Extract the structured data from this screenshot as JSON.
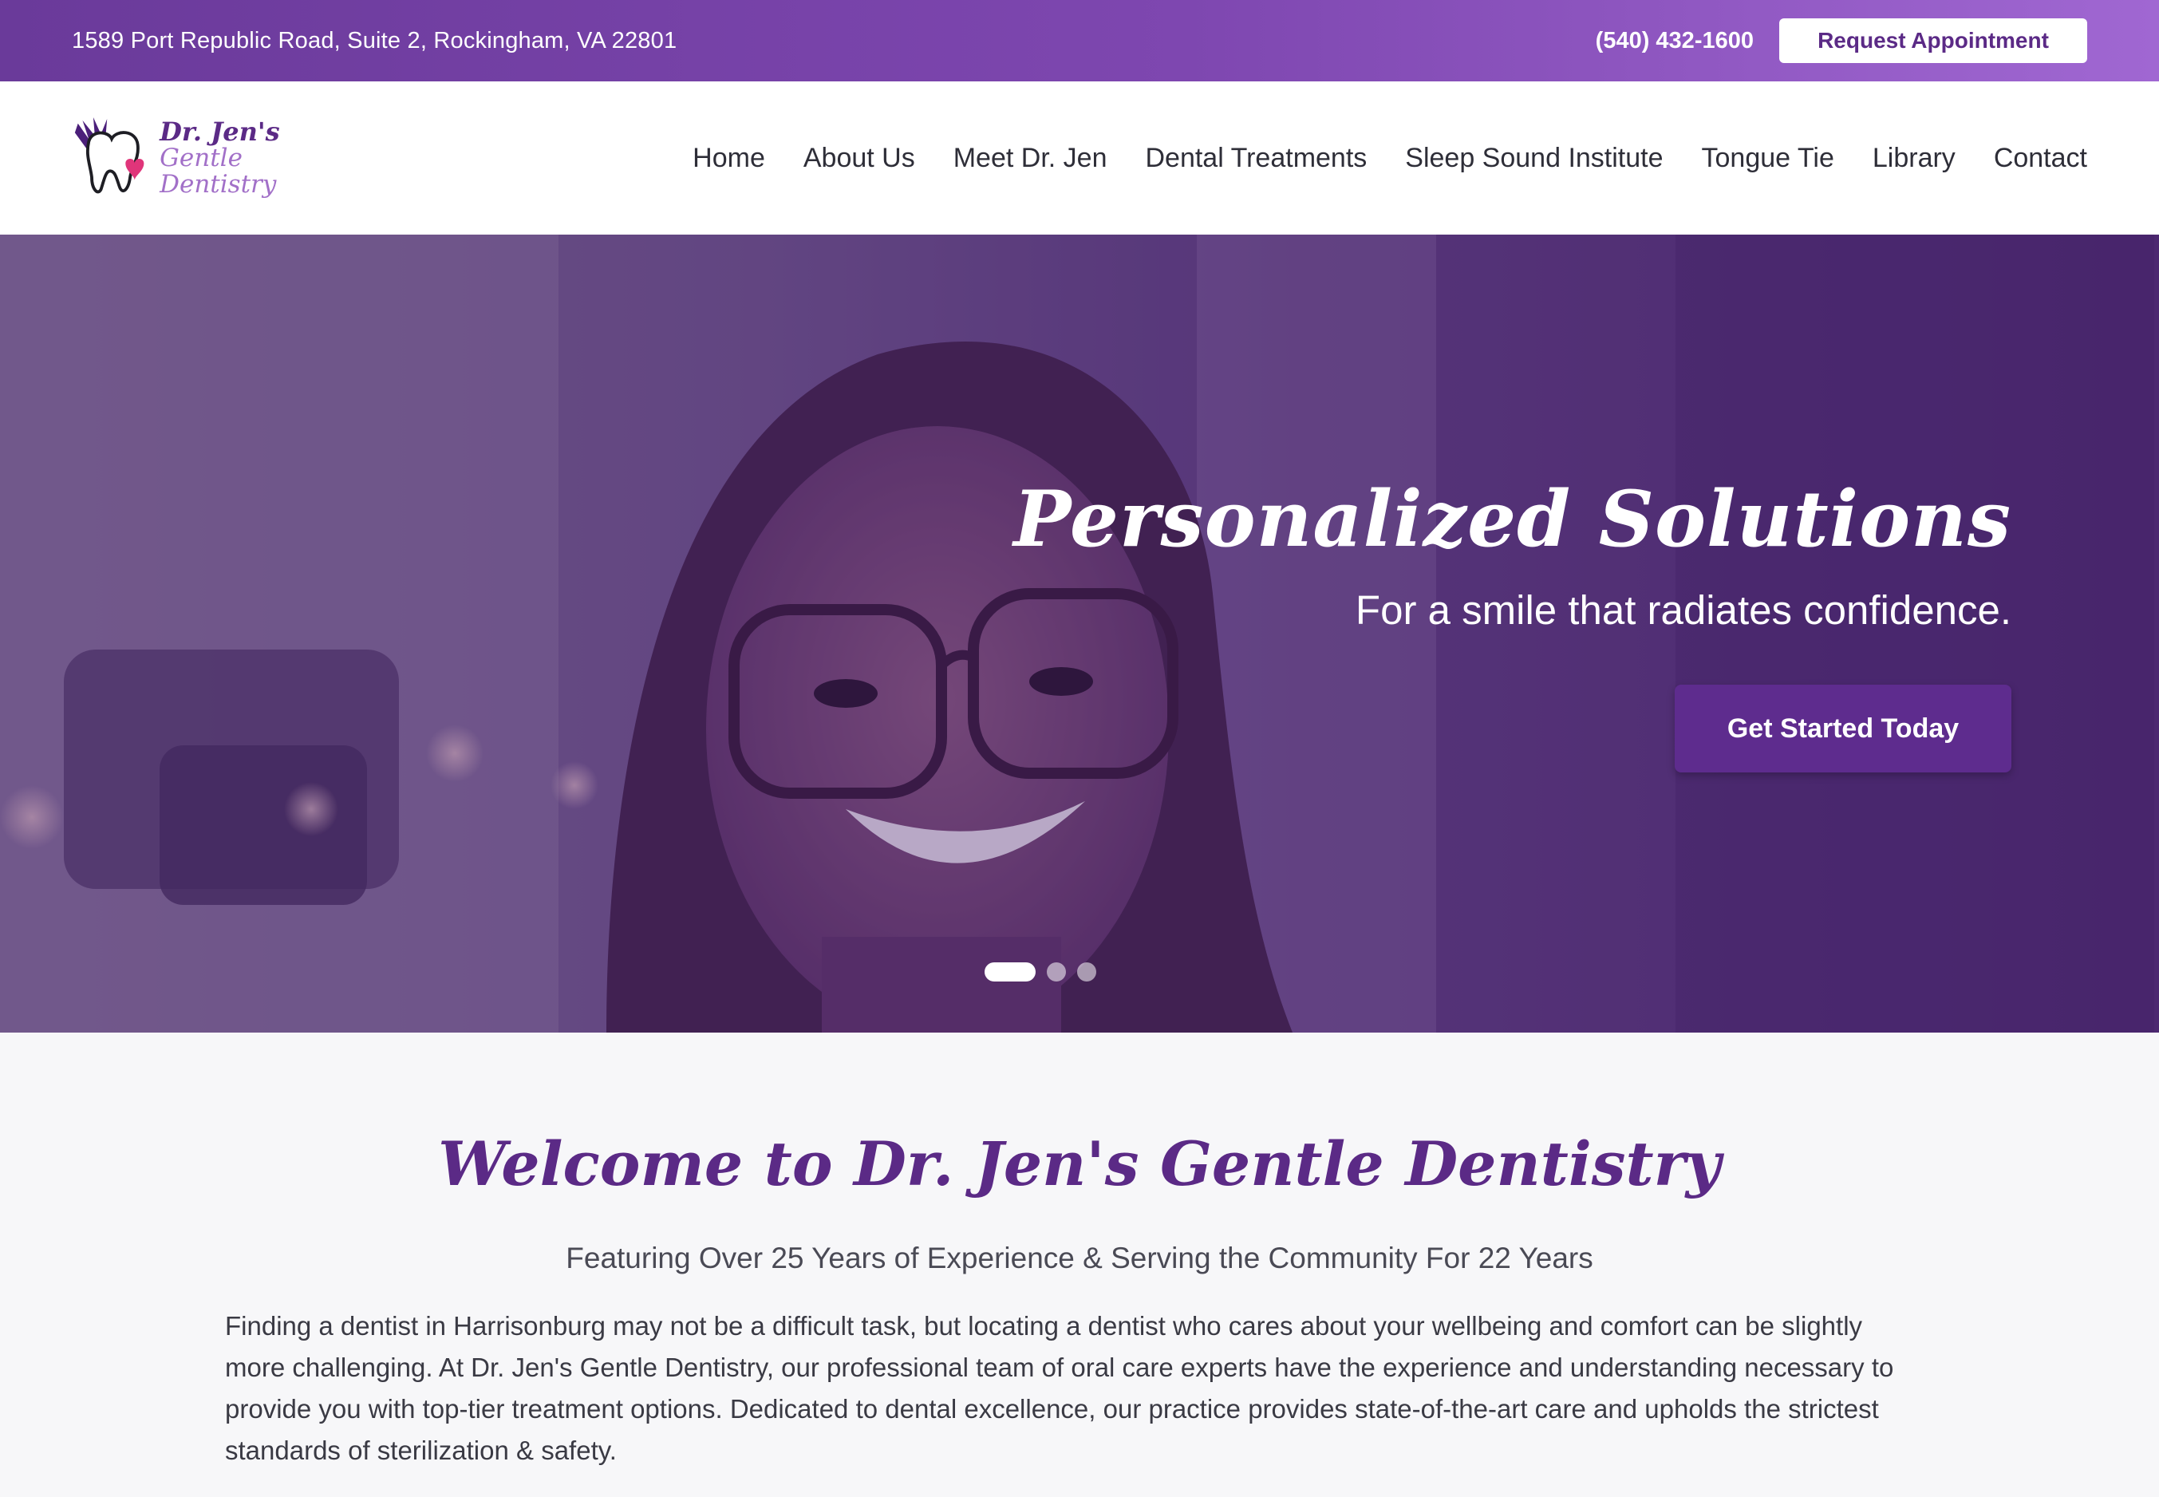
{
  "topbar": {
    "address": "1589 Port Republic Road, Suite 2, Rockingham, VA 22801",
    "phone": "(540) 432-1600",
    "request_label": "Request Appointment"
  },
  "logo": {
    "line1": "Dr. Jen's",
    "line2": "Gentle Dentistry",
    "icon": "tooth-heart-icon"
  },
  "nav": {
    "items": [
      "Home",
      "About Us",
      "Meet Dr. Jen",
      "Dental Treatments",
      "Sleep Sound Institute",
      "Tongue Tie",
      "Library",
      "Contact"
    ]
  },
  "hero": {
    "title": "Personalized Solutions",
    "subtitle": "For a smile that radiates confidence.",
    "cta_label": "Get Started Today",
    "slides": {
      "count": 3,
      "active": 1
    }
  },
  "welcome": {
    "heading": "Welcome to Dr. Jen's Gentle Dentistry",
    "tagline": "Featuring Over 25 Years of Experience & Serving the Community For 22 Years",
    "body": "Finding a dentist in Harrisonburg may not be a difficult task, but locating a dentist who cares about your wellbeing and comfort can be slightly more challenging. At Dr. Jen's Gentle Dentistry, our professional team of oral care experts have the experience and understanding necessary to provide you with top-tier treatment options. Dedicated to dental excellence, our practice provides state-of-the-art care and upholds the strictest standards of sterilization & safety."
  },
  "colors": {
    "brand": "#5b2a86",
    "accent": "#a270c8",
    "topbar_start": "#6a3a9a",
    "topbar_end": "#a067d2"
  }
}
